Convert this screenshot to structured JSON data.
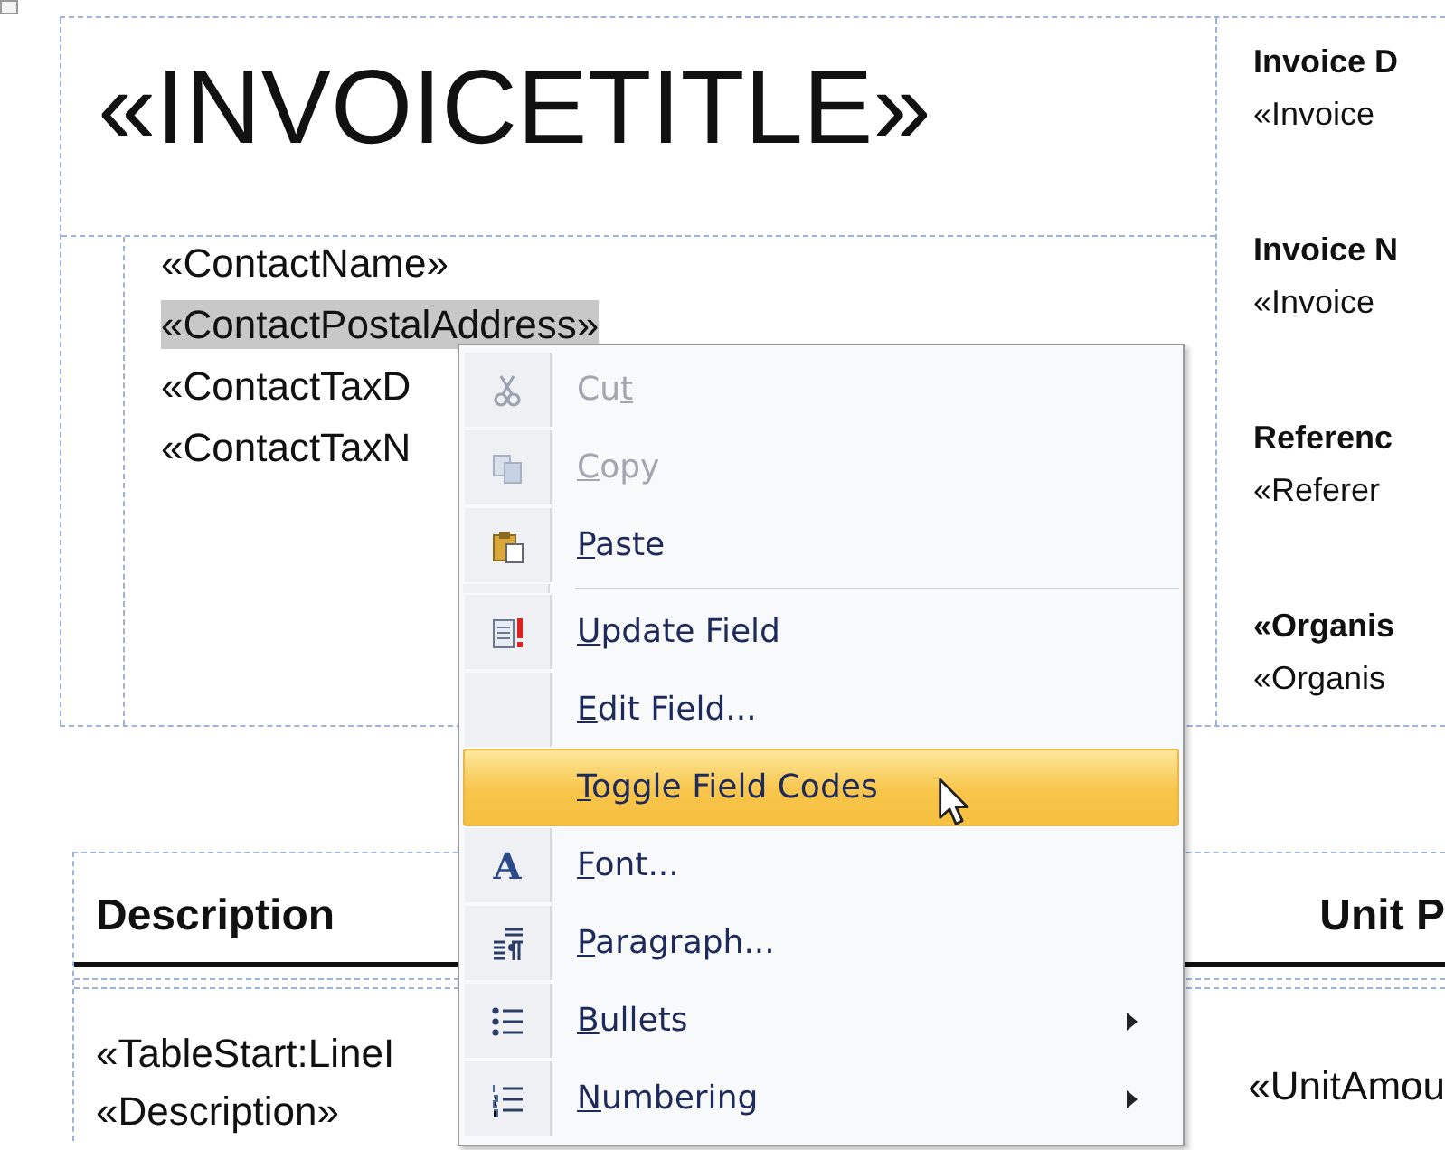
{
  "document": {
    "title_field": "«INVOICETITLE»",
    "contact_fields": [
      {
        "text": "«ContactName»",
        "selected": false
      },
      {
        "text": "«ContactPostalAddress»",
        "selected": true
      },
      {
        "text": "«ContactTaxD",
        "selected": false
      },
      {
        "text": "«ContactTaxN",
        "selected": false
      }
    ],
    "details": [
      {
        "label": "Invoice D",
        "value": "«Invoice"
      },
      {
        "label": "Invoice N",
        "value": "«Invoice"
      },
      {
        "label": "Referenc",
        "value": "«Referer"
      },
      {
        "label": "«Organis",
        "value": "«Organis"
      }
    ],
    "line_table": {
      "columns": [
        "Description",
        "Unit P"
      ],
      "rows": [
        {
          "column_1": [
            "«TableStart:LineI",
            "«Description»"
          ],
          "column_2": "«UnitAmou"
        }
      ]
    }
  },
  "context_menu": {
    "items": [
      {
        "kind": "item",
        "label": [
          {
            "text": "Cu",
            "underline": false
          },
          {
            "text": "t",
            "underline": true
          }
        ],
        "disabled": true,
        "selected": false,
        "submenu": false
      },
      {
        "kind": "item",
        "label": [
          {
            "text": "C",
            "underline": true
          },
          {
            "text": "opy",
            "underline": false
          }
        ],
        "disabled": true,
        "selected": false,
        "submenu": false
      },
      {
        "kind": "item",
        "label": [
          {
            "text": "P",
            "underline": true
          },
          {
            "text": "aste",
            "underline": false
          }
        ],
        "disabled": false,
        "selected": false,
        "submenu": false
      },
      {
        "kind": "separator"
      },
      {
        "kind": "item",
        "label": [
          {
            "text": "U",
            "underline": true
          },
          {
            "text": "pdate Field",
            "underline": false
          }
        ],
        "disabled": false,
        "selected": false,
        "submenu": false
      },
      {
        "kind": "item",
        "label": [
          {
            "text": "E",
            "underline": true
          },
          {
            "text": "dit Field...",
            "underline": false
          }
        ],
        "disabled": false,
        "selected": false,
        "submenu": false
      },
      {
        "kind": "item",
        "label": [
          {
            "text": "T",
            "underline": true
          },
          {
            "text": "oggle Field Codes",
            "underline": false
          }
        ],
        "disabled": false,
        "selected": true,
        "submenu": false
      },
      {
        "kind": "item",
        "glyph": "A",
        "label": [
          {
            "text": "F",
            "underline": true
          },
          {
            "text": "ont...",
            "underline": false
          }
        ],
        "disabled": false,
        "selected": false,
        "submenu": false
      },
      {
        "kind": "item",
        "label": [
          {
            "text": "P",
            "underline": true
          },
          {
            "text": "aragraph...",
            "underline": false
          }
        ],
        "disabled": false,
        "selected": false,
        "submenu": false
      },
      {
        "kind": "item",
        "label": [
          {
            "text": "B",
            "underline": true
          },
          {
            "text": "ullets",
            "underline": false
          }
        ],
        "disabled": false,
        "selected": false,
        "submenu": true
      },
      {
        "kind": "item",
        "label": [
          {
            "text": "N",
            "underline": true
          },
          {
            "text": "umbering",
            "underline": false
          }
        ],
        "disabled": false,
        "selected": false,
        "submenu": true
      }
    ]
  }
}
